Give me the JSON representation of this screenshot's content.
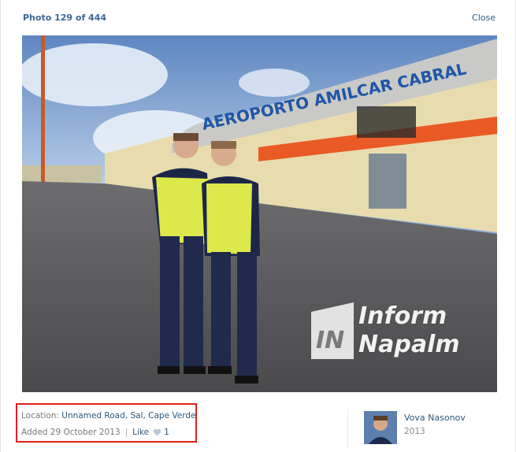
{
  "header": {
    "counter": "Photo 129 of 444",
    "close_label": "Close"
  },
  "photo": {
    "building_sign": "AEROPORTO AMILCAR CABRAL",
    "watermark": {
      "logo_text": "IN",
      "line1": "Inform",
      "line2": "Napalm"
    }
  },
  "info": {
    "location_label": "Location:",
    "location_value": "Unnamed Road, Sal, Cape Verde",
    "added_text": "Added 29 October 2013",
    "separator": "|",
    "like_label": "Like",
    "like_count": "1"
  },
  "author": {
    "name": "Vova Nasonov",
    "year": "2013"
  },
  "colors": {
    "link": "#2b587a",
    "highlight_box": "#e0201c"
  },
  "icons": {
    "like": "heart-icon",
    "avatar": "user-avatar"
  }
}
